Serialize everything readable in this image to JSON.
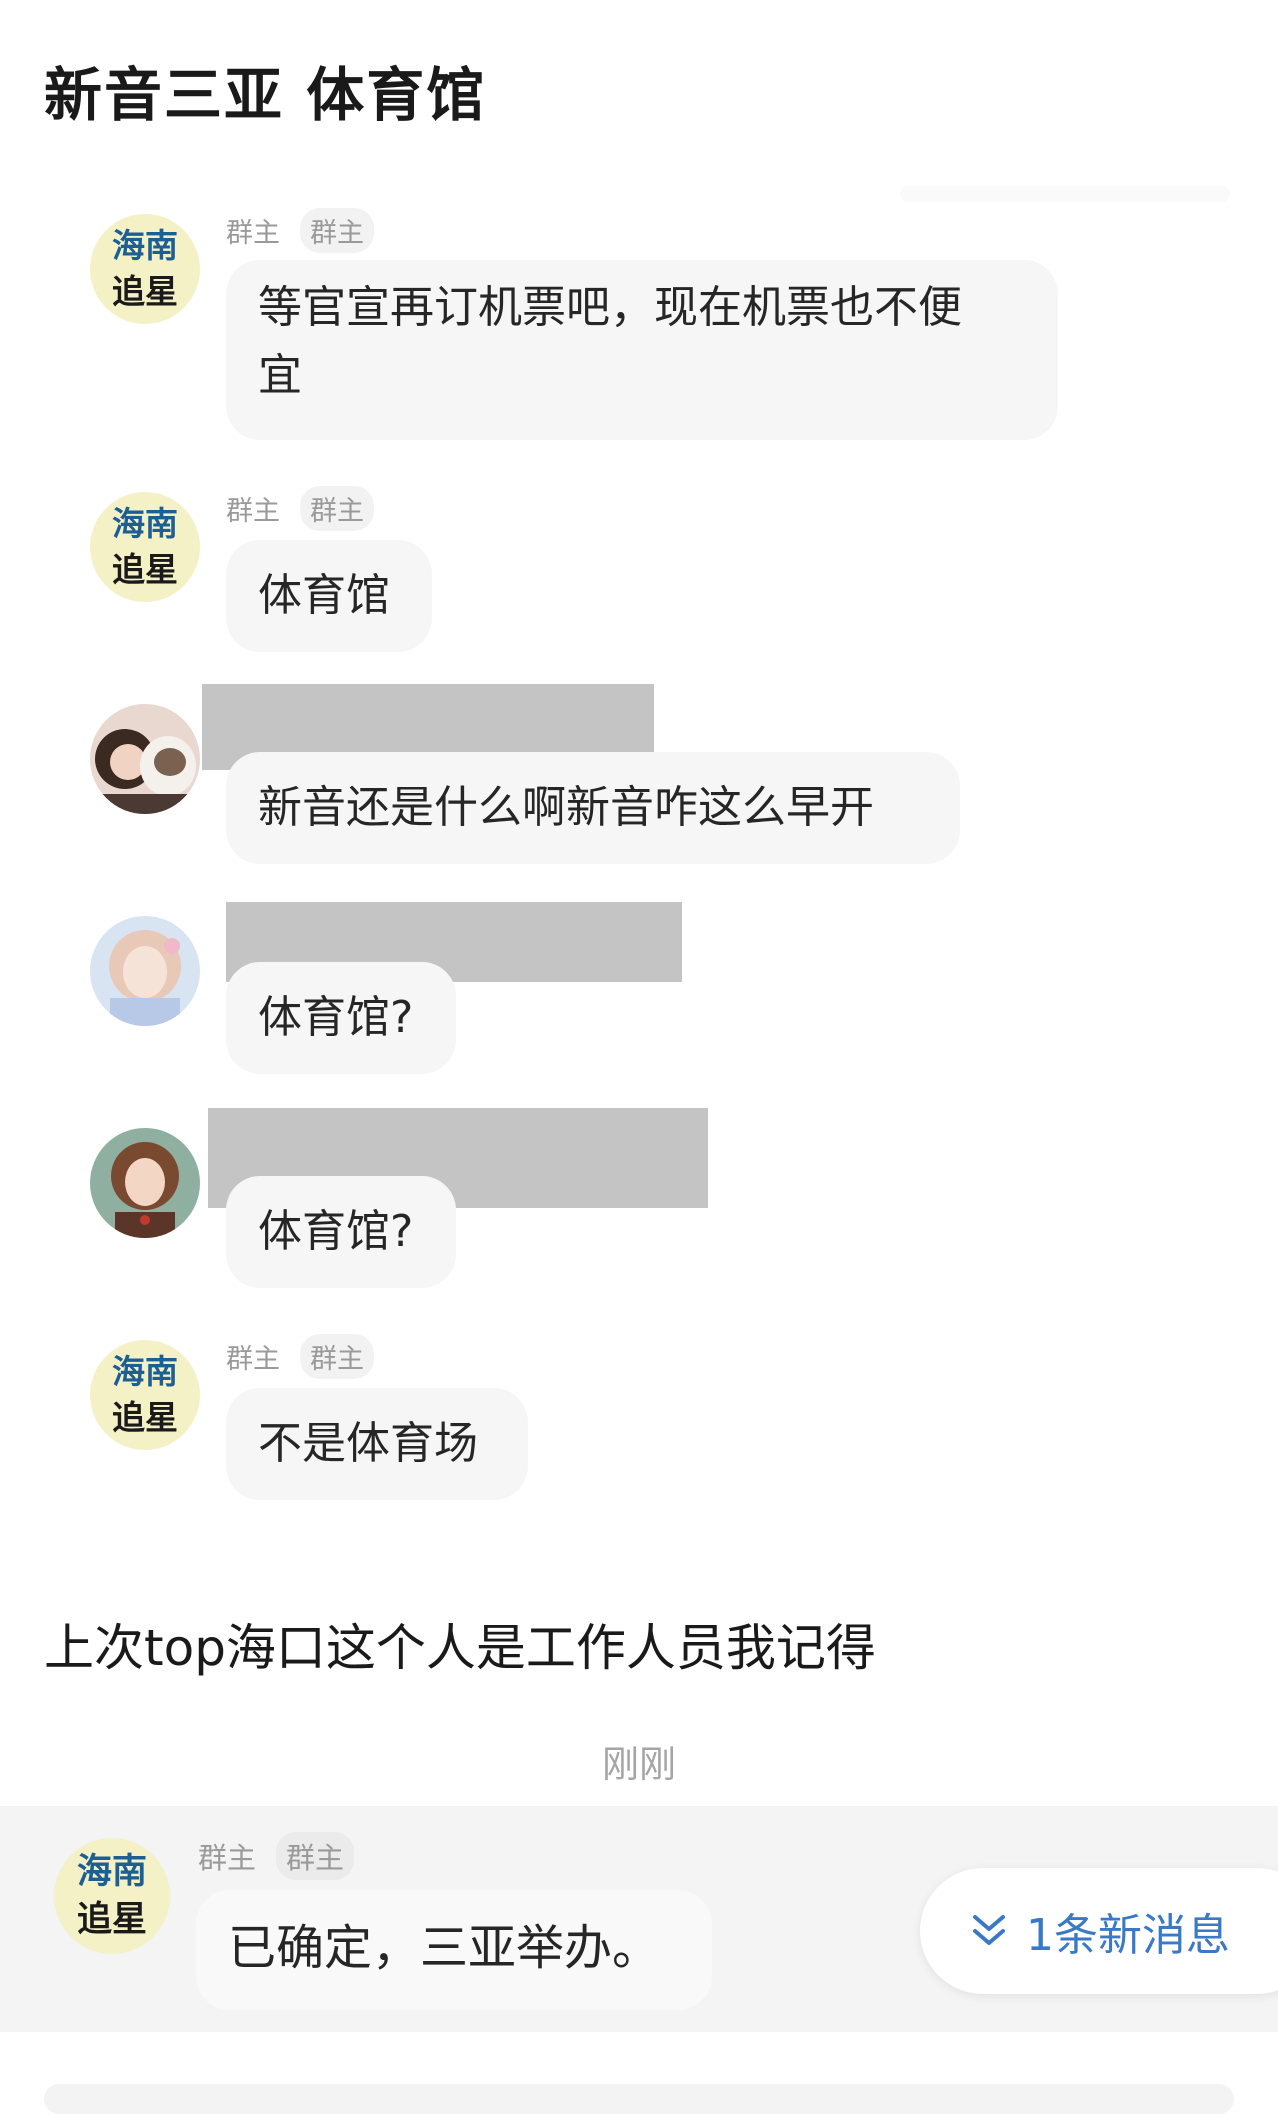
{
  "post": {
    "title": "新音三亚 体育馆",
    "body_text": "上次top海口这个人是工作人员我记得"
  },
  "group_avatar": {
    "line1": "海南",
    "line2": "追星"
  },
  "messages": [
    {
      "badge1": "群主",
      "badge2": "群主",
      "text_line1": "等官宣再订机票吧，现在机票也不便",
      "text_line2": "宜"
    },
    {
      "badge1": "群主",
      "badge2": "群主",
      "text": "体育馆"
    },
    {
      "text": "新音还是什么啊新音咋这么早开"
    },
    {
      "text": "体育馆?"
    },
    {
      "text": "体育馆?"
    },
    {
      "badge1": "群主",
      "badge2": "群主",
      "text": "不是体育场"
    }
  ],
  "timestamp": "刚刚",
  "latest": {
    "badge1": "群主",
    "badge2": "群主",
    "text": "已确定，三亚举办。"
  },
  "new_messages_button": {
    "label": "1条新消息",
    "icon": "double-chevron-down-icon",
    "color": "#3a79c6"
  }
}
